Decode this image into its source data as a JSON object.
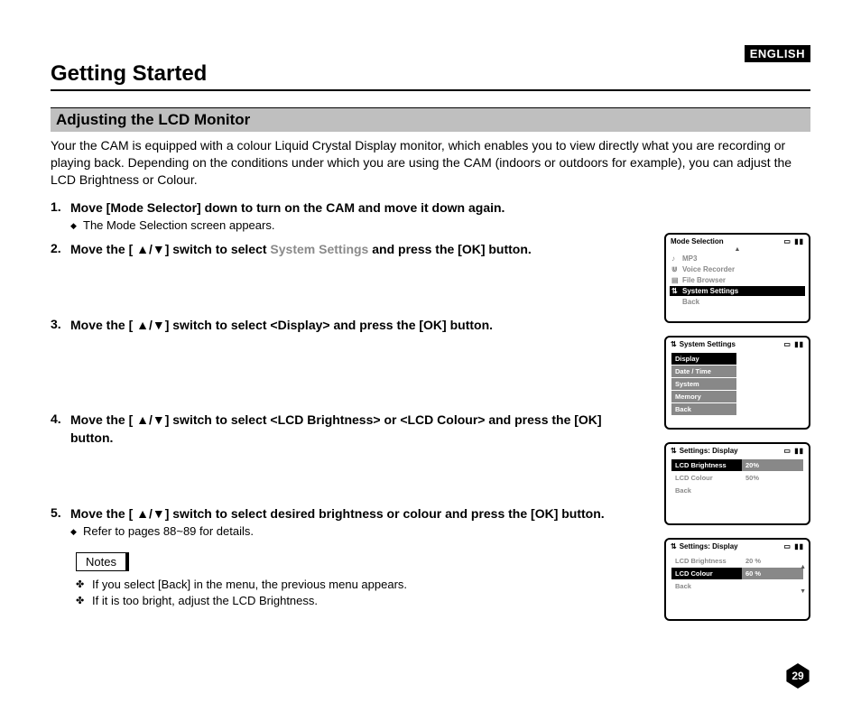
{
  "language_tag": "ENGLISH",
  "chapter": "Getting Started",
  "section": "Adjusting the LCD Monitor",
  "intro": "Your the CAM is equipped with a colour Liquid Crystal Display monitor, which enables you to view directly what you are recording or playing back. Depending on the conditions under which you are using the CAM (indoors or outdoors for example), you can adjust the LCD Brightness or Colour.",
  "steps": {
    "s1": {
      "num": "1.",
      "instr": "Move [Mode Selector] down to turn on the CAM and move it down again.",
      "sub": "The Mode Selection screen appears."
    },
    "s2": {
      "num": "2.",
      "instr_a": "Move the [ ▲/▼] switch to select ",
      "instr_light": "System Settings",
      "instr_b": " and press the [OK] button."
    },
    "s3": {
      "num": "3.",
      "instr": "Move the [ ▲/▼] switch to select <Display> and press the [OK] button."
    },
    "s4": {
      "num": "4.",
      "instr": "Move the [ ▲/▼] switch to select <LCD Brightness> or <LCD Colour> and press the [OK] button."
    },
    "s5": {
      "num": "5.",
      "instr": "Move the [ ▲/▼] switch to select desired brightness or colour and press the [OK] button.",
      "sub": "Refer to pages 88~89 for details."
    }
  },
  "notes_label": "Notes",
  "notes": {
    "n1": "If you select [Back] in the menu, the previous menu appears.",
    "n2": "If it is too bright, adjust the LCD Brightness."
  },
  "screens": {
    "s2": {
      "tag": "2",
      "title": "Mode Selection",
      "items": {
        "mp3": "MP3",
        "voice": "Voice Recorder",
        "file": "File Browser",
        "sys": "System Settings",
        "back": "Back"
      }
    },
    "s3": {
      "tag": "3",
      "title": "System Settings",
      "items": {
        "display": "Display",
        "datetime": "Date / Time",
        "system": "System",
        "memory": "Memory",
        "back": "Back"
      }
    },
    "s4": {
      "tag": "4",
      "title": "Settings: Display",
      "rows": {
        "bright_l": "LCD Brightness",
        "bright_v": "20%",
        "colour_l": "LCD Colour",
        "colour_v": "50%",
        "back": "Back"
      }
    },
    "s5": {
      "tag": "5",
      "title": "Settings: Display",
      "rows": {
        "bright_l": "LCD Brightness",
        "bright_v": "20 %",
        "colour_l": "LCD Colour",
        "colour_v": "60 %",
        "back": "Back"
      }
    }
  },
  "page_number": "29",
  "icon_glyphs": {
    "card": "▭",
    "battery": "▮▮",
    "note": "♪",
    "mic": "⋓",
    "folder": "▤",
    "sliders": "⇅"
  }
}
